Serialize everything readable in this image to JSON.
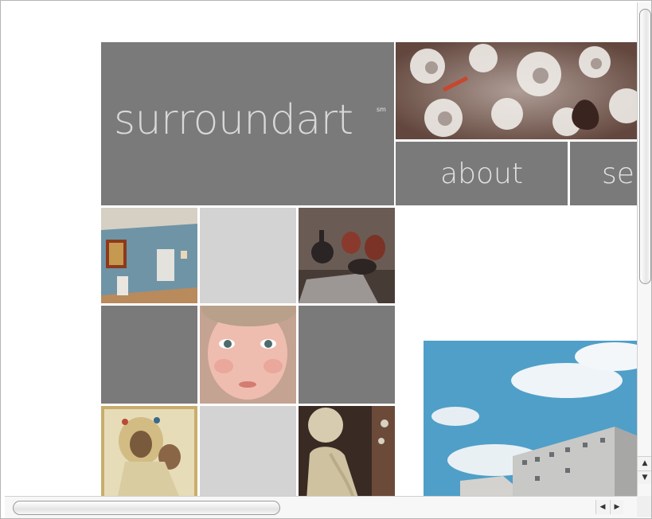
{
  "site": {
    "logo_text": "surroundart",
    "logo_mark": "sm"
  },
  "nav": {
    "about": "about",
    "services_partial": "ser"
  },
  "images": [
    "gallery-room-photo",
    "jewel-brooch-photo",
    "pottery-vessels-photo",
    "portrait-face-photo",
    "madonna-icon-photo",
    "sculpture-bust-photo",
    "building-sky-photo"
  ],
  "colors": {
    "tile_dark": "#7a7a7a",
    "tile_light": "#d3d3d3",
    "logo_text": "#d8d8d8"
  },
  "scrollbars": {
    "up_icon": "up-arrow-icon",
    "down_icon": "down-arrow-icon",
    "left_icon": "left-arrow-icon",
    "right_icon": "right-arrow-icon"
  }
}
